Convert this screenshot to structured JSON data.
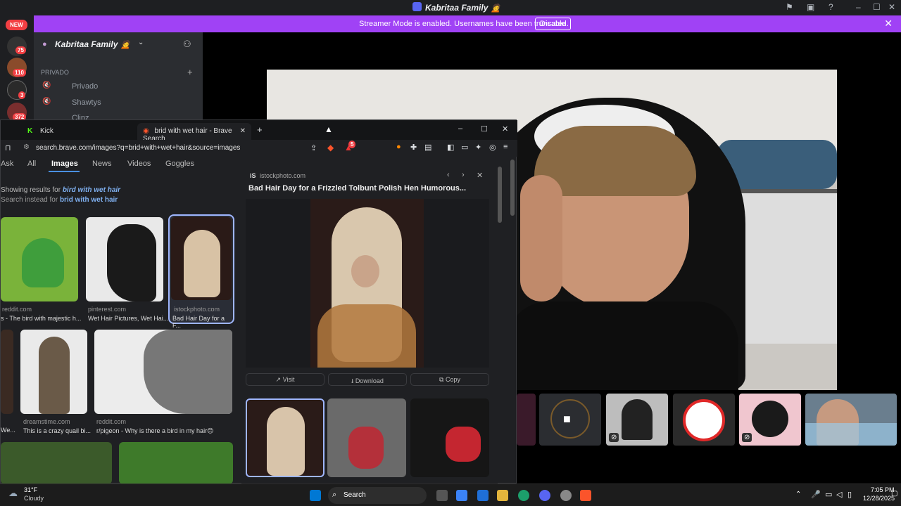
{
  "discord": {
    "title": "Kabritaa Family 🙍",
    "banner": {
      "message": "Streamer Mode is enabled. Usernames have been truncated.",
      "disable_label": "Disable"
    },
    "rail": {
      "new_label": "NEW",
      "badges": [
        "75",
        "110",
        "3",
        "372"
      ]
    },
    "server_name": "Kabritaa Family 🙍",
    "category": "PRIVADO",
    "channels": [
      "Privado",
      "Shawtys",
      "Clinz"
    ]
  },
  "browser": {
    "tabs": [
      {
        "label": "Kick"
      },
      {
        "label": "brid with wet hair - Brave Search"
      }
    ],
    "url": "search.brave.com/images?q=brid+with+wet+hair&source=images",
    "extension_badge": "5",
    "nav": [
      "Ask",
      "All",
      "Images",
      "News",
      "Videos",
      "Goggles"
    ],
    "showing_prefix": "Showing results for",
    "showing_query": "bird with wet hair",
    "search_instead_prefix": "Search instead for",
    "search_instead_query": "brid with wet hair",
    "results": [
      {
        "source": "reddit.com",
        "title": "s - The bird with majestic h..."
      },
      {
        "source": "pinterest.com",
        "title": "Wet Hair Pictures, Wet Hai..."
      },
      {
        "source": "istockphoto.com",
        "title": "Bad Hair Day for a F..."
      },
      {
        "source": "",
        "title": "We..."
      },
      {
        "source": "dreamstime.com",
        "title": "This is a crazy quail bi..."
      },
      {
        "source": "reddit.com",
        "title": "r/pigeon - Why is there a bird in my hair😊"
      }
    ],
    "panel": {
      "site": "istockphoto.com",
      "title": "Bad Hair Day for a Frizzled Tolbunt Polish Hen Humorous...",
      "visit_label": "Visit",
      "download_label": "Download",
      "copy_label": "Copy"
    }
  },
  "taskbar": {
    "weather_temp": "31°F",
    "weather_desc": "Cloudy",
    "search_label": "Search",
    "time": "7:05 PM",
    "date": "12/28/2025"
  },
  "colors": {
    "banner": "#a042f5",
    "accent_blue": "#4a90e2",
    "brave_orange": "#fb542b"
  }
}
